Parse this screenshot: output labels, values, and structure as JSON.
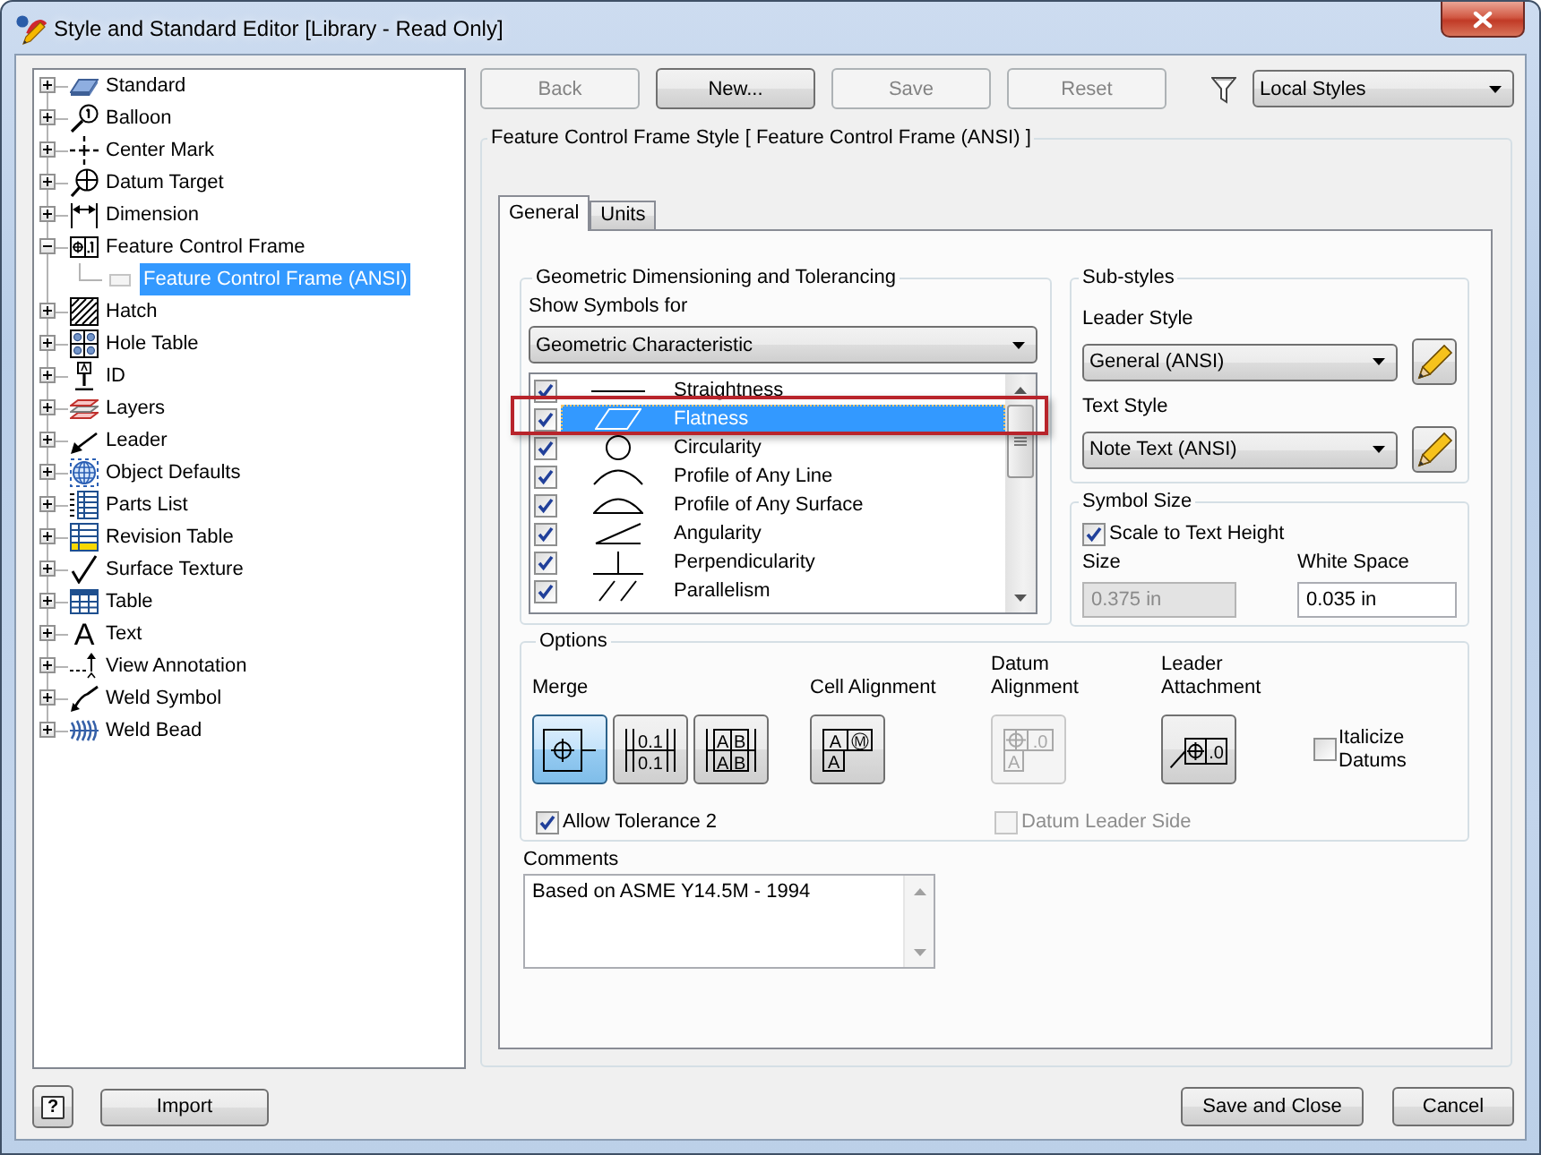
{
  "window": {
    "title": "Style and Standard Editor [Library - Read Only]"
  },
  "tree": [
    {
      "label": "Standard",
      "expanded": false,
      "selected": false
    },
    {
      "label": "Balloon",
      "expanded": false,
      "selected": false
    },
    {
      "label": "Center Mark",
      "expanded": false,
      "selected": false
    },
    {
      "label": "Datum Target",
      "expanded": false,
      "selected": false
    },
    {
      "label": "Dimension",
      "expanded": false,
      "selected": false
    },
    {
      "label": "Feature Control Frame",
      "expanded": true,
      "selected": false,
      "children": [
        {
          "label": "Feature Control Frame (ANSI)",
          "selected": true
        }
      ]
    },
    {
      "label": "Hatch",
      "expanded": false,
      "selected": false
    },
    {
      "label": "Hole Table",
      "expanded": false,
      "selected": false
    },
    {
      "label": "ID",
      "expanded": false,
      "selected": false
    },
    {
      "label": "Layers",
      "expanded": false,
      "selected": false
    },
    {
      "label": "Leader",
      "expanded": false,
      "selected": false
    },
    {
      "label": "Object Defaults",
      "expanded": false,
      "selected": false
    },
    {
      "label": "Parts List",
      "expanded": false,
      "selected": false
    },
    {
      "label": "Revision Table",
      "expanded": false,
      "selected": false
    },
    {
      "label": "Surface Texture",
      "expanded": false,
      "selected": false
    },
    {
      "label": "Table",
      "expanded": false,
      "selected": false
    },
    {
      "label": "Text",
      "expanded": false,
      "selected": false,
      "glyph": "A"
    },
    {
      "label": "View Annotation",
      "expanded": false,
      "selected": false
    },
    {
      "label": "Weld Symbol",
      "expanded": false,
      "selected": false
    },
    {
      "label": "Weld Bead",
      "expanded": false,
      "selected": false
    }
  ],
  "toolbar": {
    "buttons": [
      {
        "label": "Back",
        "disabled": true
      },
      {
        "label": "New...",
        "disabled": false
      },
      {
        "label": "Save",
        "disabled": true
      },
      {
        "label": "Reset",
        "disabled": true
      }
    ],
    "filter": {
      "value": "Local Styles"
    }
  },
  "style_panel": {
    "title": "Feature Control Frame Style [ Feature Control Frame (ANSI) ]",
    "tabs": [
      {
        "label": "General",
        "selected": true
      },
      {
        "label": "Units",
        "selected": false
      }
    ]
  },
  "gdt": {
    "title": "Geometric Dimensioning and Tolerancing",
    "show_symbols_for": {
      "label": "Show Symbols for",
      "value": "Geometric Characteristic"
    },
    "symbols": [
      {
        "name": "Straightness",
        "checked": true,
        "selected": false,
        "highlighted": false
      },
      {
        "name": "Flatness",
        "checked": true,
        "selected": true,
        "highlighted": true
      },
      {
        "name": "Circularity",
        "checked": true,
        "selected": false,
        "highlighted": false
      },
      {
        "name": "Profile of Any Line",
        "checked": true,
        "selected": false,
        "highlighted": false
      },
      {
        "name": "Profile of Any Surface",
        "checked": true,
        "selected": false,
        "highlighted": false
      },
      {
        "name": "Angularity",
        "checked": true,
        "selected": false,
        "highlighted": false
      },
      {
        "name": "Perpendicularity",
        "checked": true,
        "selected": false,
        "highlighted": false
      },
      {
        "name": "Parallelism",
        "checked": true,
        "selected": false,
        "highlighted": false
      }
    ]
  },
  "sub_styles": {
    "title": "Sub-styles",
    "leader_style": {
      "label": "Leader Style",
      "value": "General (ANSI)"
    },
    "text_style": {
      "label": "Text Style",
      "value": "Note Text (ANSI)"
    }
  },
  "symbol_size": {
    "title": "Symbol Size",
    "scale_to_text_height": {
      "label": "Scale to Text Height",
      "checked": true
    },
    "size": {
      "label": "Size",
      "value": "0.375 in",
      "disabled": true
    },
    "white_space": {
      "label": "White Space",
      "value": "0.035 in",
      "disabled": false
    }
  },
  "options": {
    "title": "Options",
    "merge": {
      "label": "Merge",
      "buttons": [
        {
          "selected": true
        },
        {
          "selected": false,
          "cells": [
            "0.1",
            "0.1"
          ]
        },
        {
          "selected": false,
          "cells": [
            "A",
            "B",
            "A",
            "B"
          ]
        }
      ]
    },
    "cell_alignment": {
      "label": "Cell Alignment",
      "cells": [
        "A",
        "Ⓜ",
        "A"
      ],
      "disabled": false
    },
    "datum_alignment": {
      "label": "Datum Alignment",
      "cells": [
        ".0",
        "A"
      ],
      "disabled": true
    },
    "leader_attachment": {
      "label": "Leader Attachment",
      "cells": [
        ".0"
      ],
      "disabled": false
    },
    "italicize_datums": {
      "label": "Italicize Datums",
      "checked": false
    },
    "allow_tolerance_2": {
      "label": "Allow Tolerance 2",
      "checked": true
    },
    "datum_leader_side": {
      "label": "Datum Leader Side",
      "checked": false,
      "disabled": true
    }
  },
  "comments": {
    "label": "Comments",
    "value": "Based on ASME Y14.5M - 1994"
  },
  "footer": {
    "help": "?",
    "import": "Import",
    "save_and_close": "Save and Close",
    "cancel": "Cancel"
  }
}
